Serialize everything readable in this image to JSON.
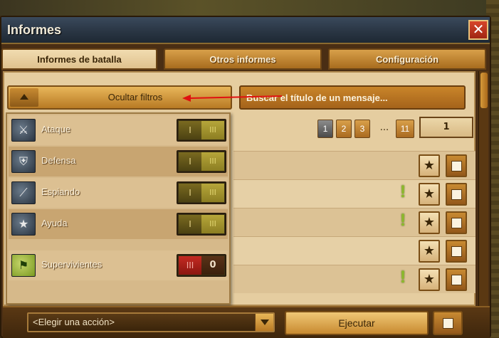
{
  "window": {
    "title": "Informes",
    "close_label": "✕"
  },
  "tabs": [
    {
      "label": "Informes de batalla",
      "active": true
    },
    {
      "label": "Otros informes",
      "active": false
    },
    {
      "label": "Configuración",
      "active": false
    }
  ],
  "filter_toggle": {
    "label": "Ocultar filtros"
  },
  "search": {
    "placeholder": "Buscar el título de un mensaje..."
  },
  "pagination": {
    "pages": [
      "1",
      "2",
      "3"
    ],
    "ellipsis": "...",
    "last_page": "11",
    "current_input": "1",
    "current_page": "1"
  },
  "filters": [
    {
      "label": "Ataque",
      "icon": "axe-icon",
      "left": "I",
      "right": "III",
      "state": "on"
    },
    {
      "label": "Defensa",
      "icon": "shield-icon",
      "left": "I",
      "right": "III",
      "state": "on"
    },
    {
      "label": "Espiando",
      "icon": "spyglass-icon",
      "left": "I",
      "right": "III",
      "state": "on"
    },
    {
      "label": "Ayuda",
      "icon": "star-shield-icon",
      "left": "I",
      "right": "III",
      "state": "on"
    },
    {
      "label": "Supervivientes",
      "icon": "flag-icon",
      "left": "III",
      "right": "0",
      "state": "off"
    }
  ],
  "report_rows": [
    {
      "has_alert": false
    },
    {
      "has_alert": true
    },
    {
      "has_alert": true
    },
    {
      "has_alert": false
    },
    {
      "has_alert": true
    }
  ],
  "icons": {
    "star": "★",
    "alert": "!"
  },
  "bottom": {
    "action_placeholder": "<Elegir una acción>",
    "execute_label": "Ejecutar"
  },
  "colors": {
    "accent": "#c88a30",
    "title_bar": "#2a3644",
    "close": "#c43420",
    "alert": "#8bbb2a",
    "annotation_arrow": "#e01010"
  }
}
